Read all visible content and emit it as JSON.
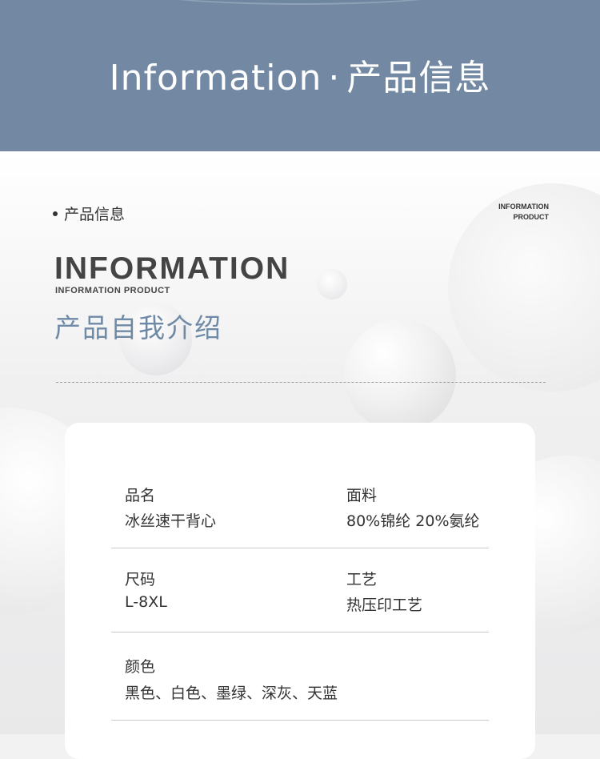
{
  "banner": {
    "title_en": "Information",
    "separator": "·",
    "title_cn": "产品信息"
  },
  "section": {
    "label": "产品信息",
    "corner_tag_line1": "INFORMATION",
    "corner_tag_line2": "PRODUCT",
    "big_title": "INFORMATION",
    "small_title": "INFORMATION PRODUCT",
    "intro_title": "产品自我介绍"
  },
  "specs": {
    "name_label": "品名",
    "name_value": "冰丝速干背心",
    "fabric_label": "面料",
    "fabric_value": "80%锦纶 20%氨纶",
    "size_label": "尺码",
    "size_value": "L-8XL",
    "craft_label": "工艺",
    "craft_value": "热压印工艺",
    "color_label": "颜色",
    "color_value": "黑色、白色、墨绿、深灰、天蓝"
  },
  "colors": {
    "banner_bg": "#7389a3",
    "accent_title": "#6f8aa6",
    "text": "#333333"
  }
}
